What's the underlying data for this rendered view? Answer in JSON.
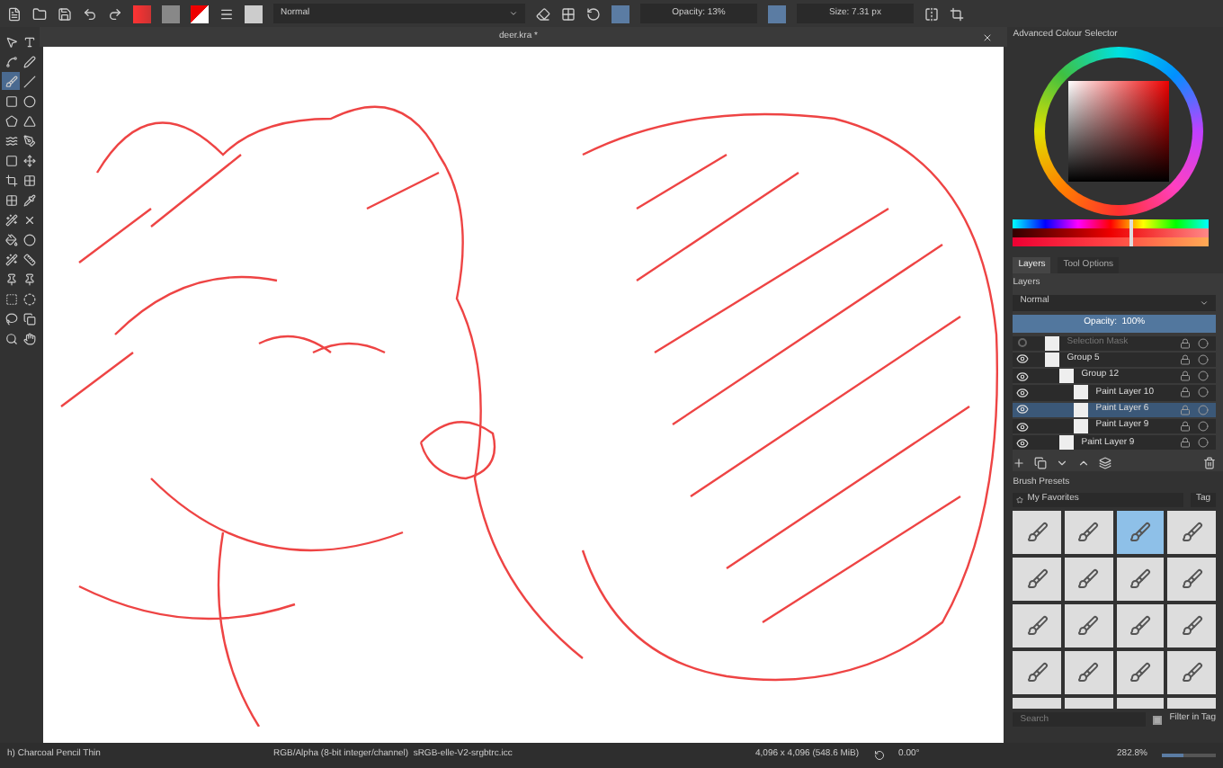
{
  "toolbar": {
    "blend_mode": "Normal",
    "opacity": "Opacity: 13%",
    "size": "Size: 7.31 px"
  },
  "tools": [
    {
      "selected": false
    },
    {
      "selected": false
    },
    {
      "selected": false
    },
    {
      "selected": false
    },
    {
      "selected": true
    },
    {
      "selected": false
    },
    {
      "selected": false
    },
    {
      "selected": false
    },
    {
      "selected": false
    },
    {
      "selected": false
    },
    {
      "selected": false
    },
    {
      "selected": false
    },
    {
      "selected": false
    },
    {
      "selected": false
    },
    {
      "selected": false
    },
    {
      "selected": false
    },
    {
      "selected": false
    },
    {
      "selected": false
    },
    {
      "selected": false
    },
    {
      "selected": false
    },
    {
      "selected": false
    },
    {
      "selected": false
    },
    {
      "selected": false
    },
    {
      "selected": false
    },
    {
      "selected": false
    },
    {
      "selected": false
    },
    {
      "selected": false
    },
    {
      "selected": false
    },
    {
      "selected": false
    },
    {
      "selected": false
    },
    {
      "selected": false
    },
    {
      "selected": false
    }
  ],
  "document_tab": {
    "title": "deer.kra *"
  },
  "colour_selector": {
    "title": "Advanced Colour Selector",
    "sliders": [
      {
        "level": 0.6
      },
      {
        "level": 0.6
      },
      {
        "level": 0.6
      }
    ]
  },
  "dock_tabs": [
    {
      "label": "Layers",
      "selected": true
    },
    {
      "label": "Tool Options",
      "selected": false
    }
  ],
  "layers": {
    "title": "Layers",
    "blend_mode": "Normal",
    "opacity": {
      "label": "Opacity:  100%",
      "level": 1
    },
    "items": [
      {
        "name": "Selection Mask",
        "visible": false,
        "selected": false
      },
      {
        "name": "Group 5",
        "visible": true,
        "selected": false,
        "children": [
          {
            "name": "Group 12",
            "visible": true,
            "selected": false,
            "children": [
              {
                "name": "Paint Layer 10",
                "visible": true,
                "selected": false
              },
              {
                "name": "Paint Layer 6",
                "visible": true,
                "selected": true
              },
              {
                "name": "Paint Layer 9",
                "visible": true,
                "selected": false
              }
            ]
          },
          {
            "name": "Paint Layer 9",
            "visible": true,
            "selected": false
          }
        ]
      }
    ]
  },
  "brush_presets": {
    "title": "Brush Presets",
    "tag": "My Favorites",
    "tag_button": "Tag",
    "search": {
      "placeholder": "Search"
    },
    "filter_in_tag": {
      "label": "Filter in Tag",
      "checked": true
    },
    "presets": [
      {
        "selected": false
      },
      {
        "selected": false
      },
      {
        "selected": true
      },
      {
        "selected": false
      },
      {
        "selected": false
      },
      {
        "selected": false
      },
      {
        "selected": false
      },
      {
        "selected": false
      },
      {
        "selected": false
      },
      {
        "selected": false
      },
      {
        "selected": false
      },
      {
        "selected": false
      },
      {
        "selected": false
      },
      {
        "selected": false
      },
      {
        "selected": false
      },
      {
        "selected": false
      },
      {
        "selected": false
      },
      {
        "selected": false
      },
      {
        "selected": false
      },
      {
        "selected": false
      }
    ]
  },
  "status_bar": {
    "brush": "h) Charcoal Pencil Thin",
    "color_space": "RGB/Alpha (8-bit integer/channel)  sRGB-elle-V2-srgbtrc.icc",
    "image_size": "4,096 x 4,096 (548.6 MiB)",
    "rotation": "0.00°",
    "zoom": "282.8%",
    "zoom_slider": {
      "level": 0.4
    }
  }
}
